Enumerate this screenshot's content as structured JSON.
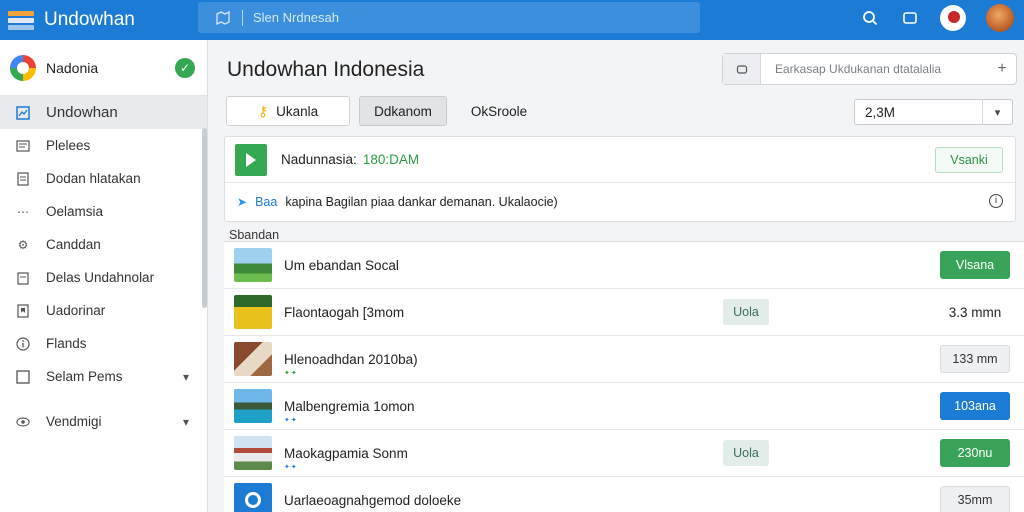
{
  "app": {
    "title": "Undowhan"
  },
  "search": {
    "placeholder": "Slen Nrdnesah"
  },
  "topbar": {
    "icons": [
      "search-icon",
      "window-icon",
      "avatar",
      "avatar"
    ]
  },
  "sidebar": {
    "account": {
      "name": "Nadonia"
    },
    "items": [
      {
        "label": "Undowhan",
        "icon": "dashboard-icon",
        "active": true
      },
      {
        "label": "Plelees",
        "icon": "list-icon"
      },
      {
        "label": "Dodan hlatakan",
        "icon": "document-icon"
      },
      {
        "label": "Oelamsia",
        "icon": "dots-icon"
      },
      {
        "label": "Canddan",
        "icon": "gear-icon"
      },
      {
        "label": "Delas Undahnolar",
        "icon": "calendar-icon"
      },
      {
        "label": "Uadorinar",
        "icon": "bookmark-icon"
      },
      {
        "label": "Flands",
        "icon": "info-icon"
      },
      {
        "label": "Selam Pems",
        "icon": "square-icon",
        "chevron": true
      },
      {
        "label": "Vendmigi",
        "icon": "eye-icon",
        "chevron": true
      }
    ]
  },
  "main": {
    "title": "Undowhan Indonesia",
    "search_placeholder": "Earkasap Ukdukanan dtatalalia",
    "tabs": [
      "Ukanla",
      "Ddkanom",
      "OkSroole"
    ],
    "select_value": "2,3M"
  },
  "card": {
    "title": "Nadunnasia:",
    "time": "180:DAM",
    "button": "Vsanki",
    "note_label": "Baa",
    "note_text": "kapina Bagilan piaa dankar demanan. Ukalaocie)"
  },
  "section_label": "Sbandan",
  "list": [
    {
      "label": "Um ebandan Socal",
      "action": "Vlsana",
      "action_style": "green",
      "tag": ""
    },
    {
      "label": "Flaontaogah [3mom",
      "action": "3.3 mmn",
      "action_style": "plain",
      "tag": "Uola"
    },
    {
      "label": "Hlenoadhdan 2010ba)",
      "action": "133 mm",
      "action_style": "grey",
      "tag": ""
    },
    {
      "label": "Malbengremia 1omon",
      "action": "103ana",
      "action_style": "blue",
      "tag": ""
    },
    {
      "label": "Maokagpamia Sonm",
      "action": "230nu",
      "action_style": "green",
      "tag": "Uola"
    },
    {
      "label": "Uarlaeoagnahgemod doloeke",
      "action": "35mm",
      "action_style": "grey",
      "tag": ""
    }
  ],
  "colors": {
    "accent": "#1c7bd4",
    "success": "#3aa35a"
  }
}
